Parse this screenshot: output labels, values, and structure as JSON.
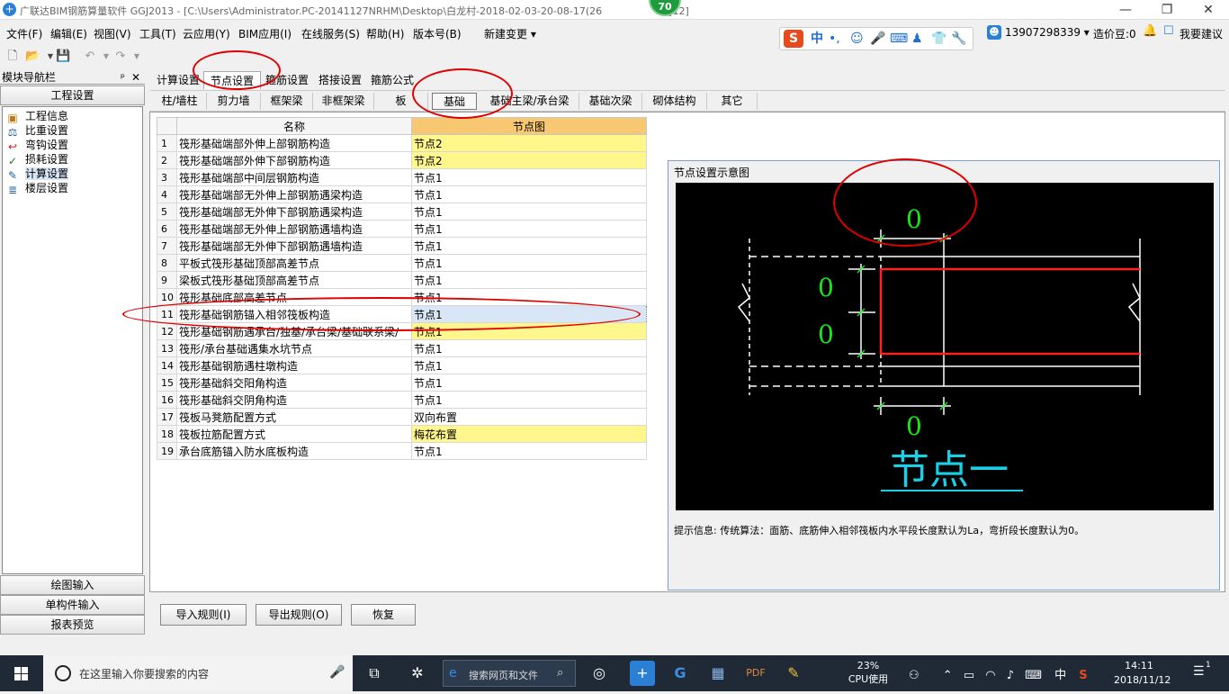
{
  "window": {
    "title": "广联达BIM钢筋算量软件 GGJ2013 - [C:\\Users\\Administrator.PC-20141127NRHM\\Desktop\\白龙村-2018-02-03-20-08-17(26",
    "title_tail": "GGJ12]",
    "badge": "70",
    "min": "—",
    "max": "❐",
    "close": "✕"
  },
  "menu": [
    "文件(F)",
    "编辑(E)",
    "视图(V)",
    "工具(T)",
    "云应用(Y)",
    "BIM应用(I)",
    "在线服务(S)",
    "帮助(H)",
    "版本号(B)",
    "新建变更 ▾"
  ],
  "account": {
    "phone": "13907298339 ▾",
    "beans": "造价豆:0",
    "suggest": "我要建议"
  },
  "ime": {
    "logo": "S",
    "mode": "中",
    "punct": "•,",
    "icons": [
      "☺",
      "🎤",
      "⌨",
      "♟",
      "👕",
      "🔧"
    ]
  },
  "nav": {
    "title": "模块导航栏",
    "pin": "ᵖ",
    "close": "✕",
    "top_section": "工程设置",
    "items": [
      {
        "label": "工程信息",
        "icon": "▣"
      },
      {
        "label": "比重设置",
        "icon": "⚖"
      },
      {
        "label": "弯钩设置",
        "icon": "↩"
      },
      {
        "label": "损耗设置",
        "icon": "✓"
      },
      {
        "label": "计算设置",
        "icon": "✎"
      },
      {
        "label": "楼层设置",
        "icon": "≣"
      }
    ],
    "bottom_sections": [
      "绘图输入",
      "单构件输入",
      "报表预览"
    ]
  },
  "main_tabs": [
    "计算设置",
    "节点设置",
    "箍筋设置",
    "搭接设置",
    "箍筋公式"
  ],
  "sub_tabs": [
    "柱/墙柱",
    "剪力墙",
    "框架梁",
    "非框架梁",
    "板",
    "基础",
    "基础主梁/承台梁",
    "基础次梁",
    "砌体结构",
    "其它"
  ],
  "grid": {
    "col_name": "名称",
    "col_node": "节点图",
    "rows": [
      {
        "n": "1",
        "name": "筏形基础端部外伸上部钢筋构造",
        "val": "节点2",
        "hl": true
      },
      {
        "n": "2",
        "name": "筏形基础端部外伸下部钢筋构造",
        "val": "节点2",
        "hl": true
      },
      {
        "n": "3",
        "name": "筏形基础端部中间层钢筋构造",
        "val": "节点1",
        "hl": false
      },
      {
        "n": "4",
        "name": "筏形基础端部无外伸上部钢筋遇梁构造",
        "val": "节点1",
        "hl": false
      },
      {
        "n": "5",
        "name": "筏形基础端部无外伸下部钢筋遇梁构造",
        "val": "节点1",
        "hl": false
      },
      {
        "n": "6",
        "name": "筏形基础端部无外伸上部钢筋遇墙构造",
        "val": "节点1",
        "hl": false
      },
      {
        "n": "7",
        "name": "筏形基础端部无外伸下部钢筋遇墙构造",
        "val": "节点1",
        "hl": false
      },
      {
        "n": "8",
        "name": "平板式筏形基础顶部高差节点",
        "val": "节点1",
        "hl": false
      },
      {
        "n": "9",
        "name": "梁板式筏形基础顶部高差节点",
        "val": "节点1",
        "hl": false
      },
      {
        "n": "10",
        "name": "筏形基础底部高差节点",
        "val": "节点1",
        "hl": false
      },
      {
        "n": "11",
        "name": "筏形基础钢筋锚入相邻筏板构造",
        "val": "节点1",
        "hl": false,
        "sel": true
      },
      {
        "n": "12",
        "name": "筏形基础钢筋遇承台/独基/承台梁/基础联系梁/",
        "val": "节点1",
        "hl": true
      },
      {
        "n": "13",
        "name": "筏形/承台基础遇集水坑节点",
        "val": "节点1",
        "hl": false
      },
      {
        "n": "14",
        "name": "筏形基础钢筋遇柱墩构造",
        "val": "节点1",
        "hl": false
      },
      {
        "n": "15",
        "name": "筏形基础斜交阳角构造",
        "val": "节点1",
        "hl": false
      },
      {
        "n": "16",
        "name": "筏形基础斜交阴角构造",
        "val": "节点1",
        "hl": false
      },
      {
        "n": "17",
        "name": "筏板马凳筋配置方式",
        "val": "双向布置",
        "hl": false
      },
      {
        "n": "18",
        "name": "筏板拉筋配置方式",
        "val": "梅花布置",
        "hl": true
      },
      {
        "n": "19",
        "name": "承台底筋锚入防水底板构造",
        "val": "节点1",
        "hl": false
      }
    ]
  },
  "diagram": {
    "title": "节点设置示意图",
    "dim_top": "0",
    "dim_left_upper": "0",
    "dim_left_lower": "0",
    "dim_bottom": "0",
    "caption": "节点一",
    "hint": "提示信息:  传统算法：面筋、底筋伸入相邻筏板内水平段长度默认为La，弯折段长度默认为0。"
  },
  "buttons": {
    "import": "导入规则(I)",
    "export": "导出规则(O)",
    "restore": "恢复"
  },
  "taskbar": {
    "search_placeholder": "在这里输入你要搜索的内容",
    "edge_text": "搜索网页和文件",
    "cpu_percent": "23%",
    "cpu_label": "CPU使用",
    "ime": "中",
    "time": "14:11",
    "date": "2018/11/12",
    "notify": "1"
  },
  "colors": {
    "accent": "#2b7fd4",
    "highlight": "#fff68c",
    "header_hl": "#f7c871",
    "annotation": "#e00000",
    "dim_green": "#19e619",
    "rebar_red": "#ff2020",
    "caption_cyan": "#19d0e6"
  }
}
